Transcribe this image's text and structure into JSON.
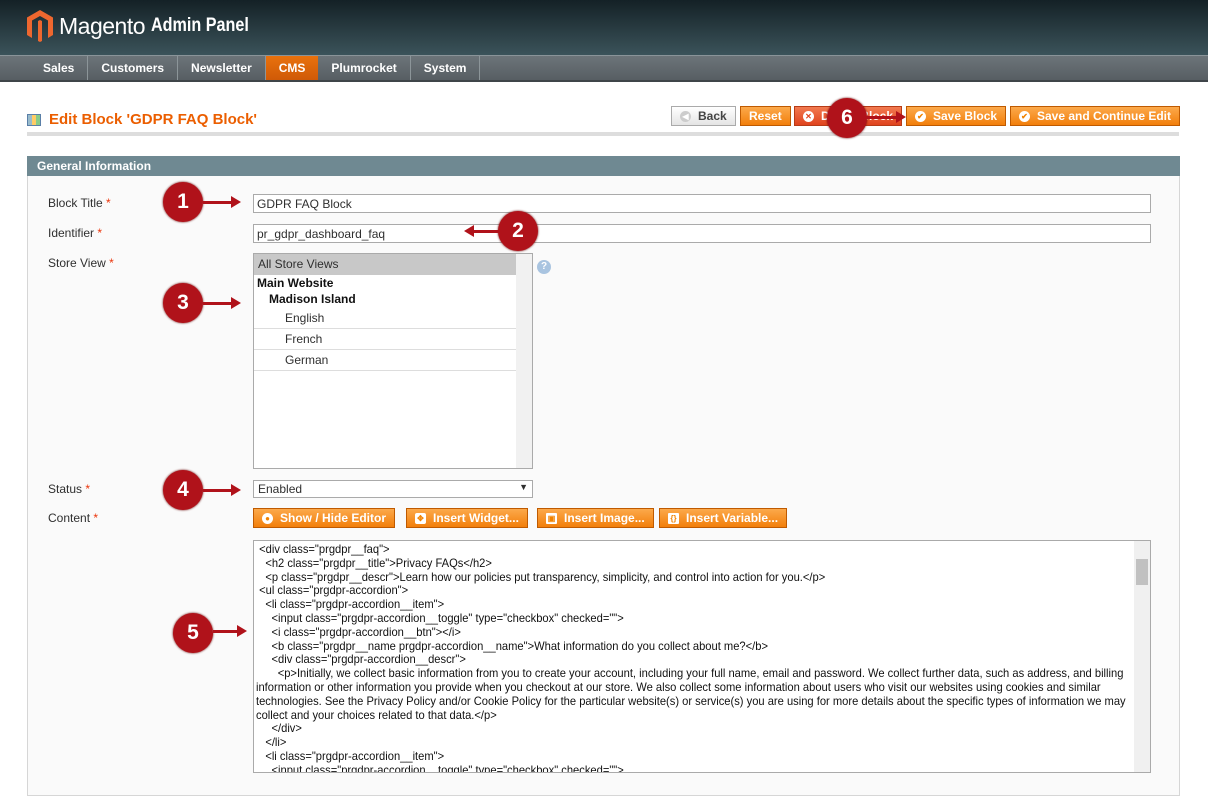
{
  "header": {
    "logo_name": "Magento",
    "logo_sub": "Admin Panel"
  },
  "nav": [
    {
      "label": "Sales"
    },
    {
      "label": "Customers"
    },
    {
      "label": "Newsletter"
    },
    {
      "label": "CMS",
      "active": true
    },
    {
      "label": "Plumrocket"
    },
    {
      "label": "System"
    }
  ],
  "page": {
    "title": "Edit Block 'GDPR FAQ Block'"
  },
  "toolbar": {
    "back": "Back",
    "reset": "Reset",
    "delete": "Delete Block",
    "save": "Save Block",
    "save_continue": "Save and Continue Edit"
  },
  "section": {
    "title": "General Information"
  },
  "form": {
    "block_title": {
      "label": "Block Title",
      "value": "GDPR FAQ Block"
    },
    "identifier": {
      "label": "Identifier",
      "value": "pr_gdpr_dashboard_faq"
    },
    "store_view": {
      "label": "Store View",
      "options": [
        "All Store Views",
        "Main Website",
        "Madison Island",
        "English",
        "French",
        "German"
      ],
      "selected": "All Store Views"
    },
    "status": {
      "label": "Status",
      "value": "Enabled"
    },
    "content": {
      "label": "Content",
      "buttons": [
        "Show / Hide Editor",
        "Insert Widget...",
        "Insert Image...",
        "Insert Variable..."
      ],
      "value": " <div class=\"prgdpr__faq\">\n   <h2 class=\"prgdpr__title\">Privacy FAQs</h2>\n   <p class=\"prgdpr__descr\">Learn how our policies put transparency, simplicity, and control into action for you.</p>\n <ul class=\"prgdpr-accordion\">\n   <li class=\"prgdpr-accordion__item\">\n     <input class=\"prgdpr-accordion__toggle\" type=\"checkbox\" checked=\"\">\n     <i class=\"prgdpr-accordion__btn\"></i>\n     <b class=\"prgdpr__name prgdpr-accordion__name\">What information do you collect about me?</b>\n     <div class=\"prgdpr-accordion__descr\">\n       <p>Initially, we collect basic information from you to create your account, including your full name, email and password. We collect further data, such as address, and billing information or other information you provide when you checkout at our store. We also collect some information about users who visit our websites using cookies and similar technologies. See the Privacy Policy and/or Cookie Policy for the particular website(s) or service(s) you are using for more details about the specific types of information we may collect and your choices related to that data.</p>\n     </div>\n   </li>\n   <li class=\"prgdpr-accordion__item\">\n     <input class=\"prgdpr-accordion__toggle\" type=\"checkbox\" checked=\"\">"
    }
  },
  "required_mark": "*",
  "markers": [
    "1",
    "2",
    "3",
    "4",
    "5",
    "6"
  ],
  "colors": {
    "accent": "#eb5e00",
    "button": "#f27f0b",
    "section_header": "#6f8992",
    "marker": "#b0121a"
  }
}
